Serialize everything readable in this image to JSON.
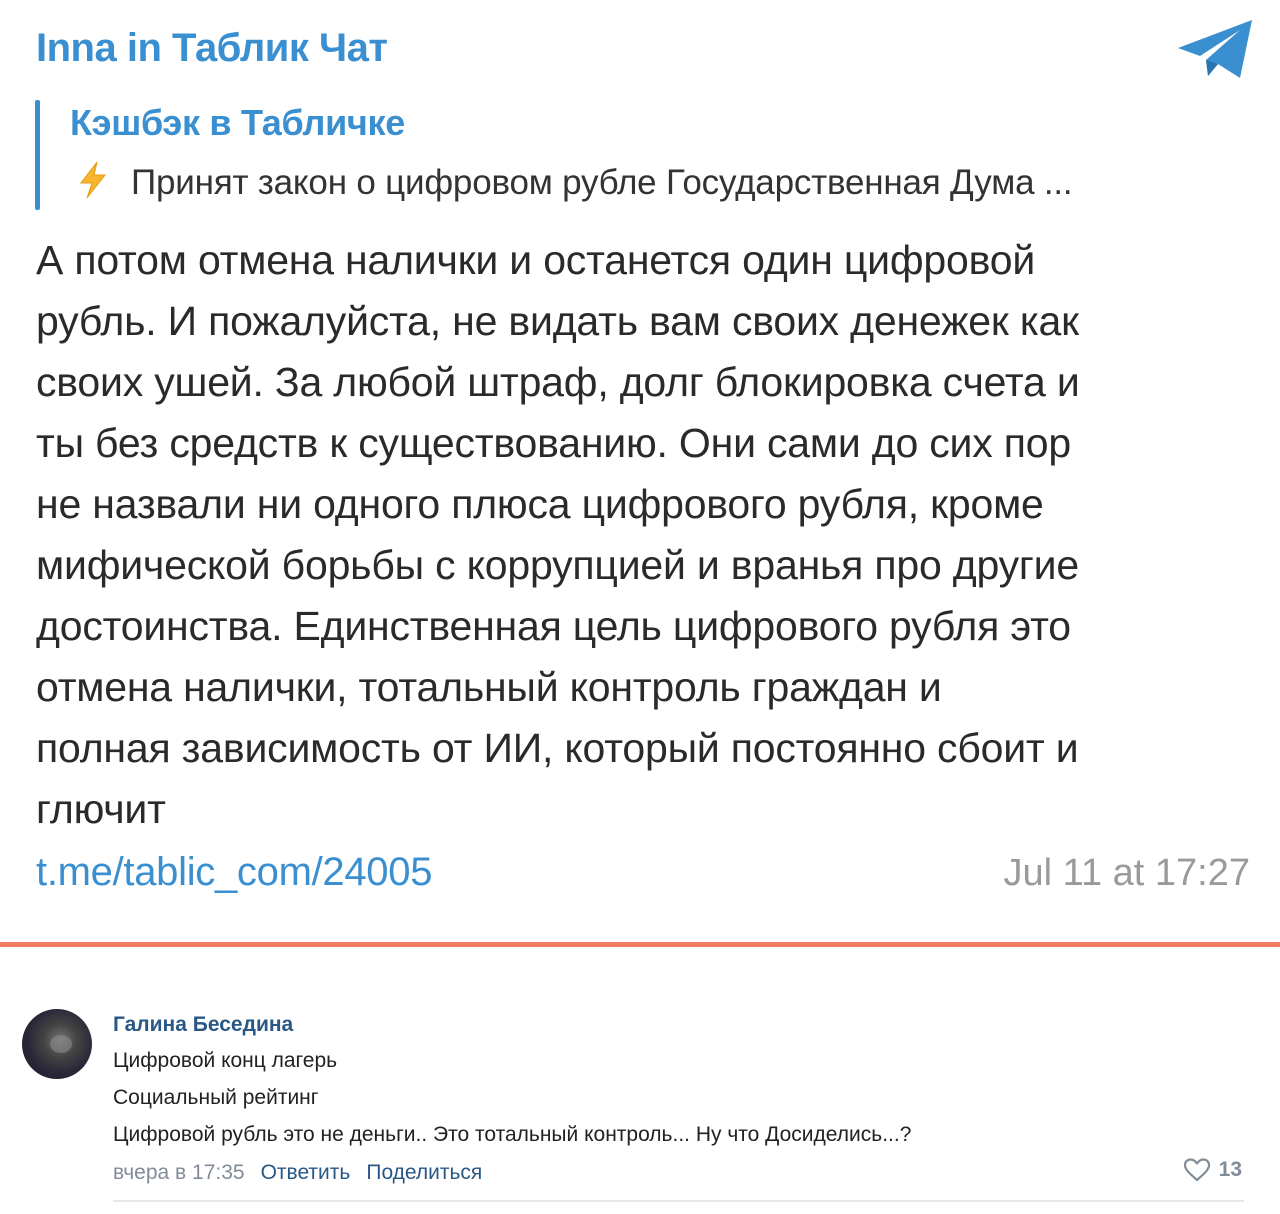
{
  "telegram_post": {
    "author": "Inna in Таблик Чат",
    "logo_icon": "telegram-plane-icon",
    "reply": {
      "title": "Кэшбэк в Табличке",
      "icon": "lightning-icon",
      "text": "Принят закон о цифровом рубле Государственная Дума ..."
    },
    "body_lines": [
      "А потом отмена налички и останется один цифровой",
      "рубль. И пожалуйста, не видать вам своих денежек как",
      "своих ушей. За любой штраф, долг блокировка счета и",
      "ты без средств к существованию. Они сами до сих пор",
      "не назвали ни одного плюса цифрового рубля, кроме",
      "мифической борьбы с коррупцией и вранья про другие",
      "достоинства. Единственная цель цифрового рубля это",
      "отмена налички, тотальный контроль граждан и",
      "полная зависимость от ИИ, который постоянно сбоит и",
      "глючит"
    ],
    "link": "t.me/tablic_com/24005",
    "timestamp": "Jul 11 at 17:27"
  },
  "colors": {
    "telegram_blue": "#3a8fd0",
    "separator": "#f07c62",
    "vk_link": "#2a5885",
    "vk_meta": "#818c99"
  },
  "vk_comment": {
    "author": "Галина Беседина",
    "lines": [
      "Цифровой конц лагерь",
      "Социальный рейтинг",
      "Цифровой рубль это не деньги.. Это тотальный контроль... Ну что Досиделись...?"
    ],
    "date": "вчера в 17:35",
    "reply_label": "Ответить",
    "share_label": "Поделиться",
    "like_icon": "heart-icon",
    "likes": "13"
  }
}
